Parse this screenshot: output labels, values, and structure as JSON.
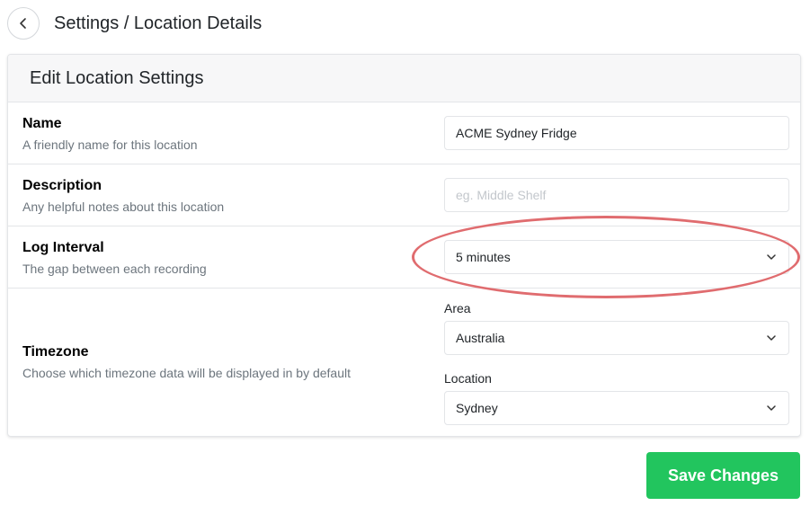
{
  "header": {
    "breadcrumb": "Settings / Location Details"
  },
  "card": {
    "title": "Edit Location Settings",
    "name": {
      "label": "Name",
      "help": "A friendly name for this location",
      "value": "ACME Sydney Fridge"
    },
    "description": {
      "label": "Description",
      "help": "Any helpful notes about this location",
      "placeholder": "eg. Middle Shelf"
    },
    "log_interval": {
      "label": "Log Interval",
      "help": "The gap between each recording",
      "value": "5 minutes"
    },
    "timezone": {
      "label": "Timezone",
      "help": "Choose which timezone data will be displayed in by default",
      "area_label": "Area",
      "area_value": "Australia",
      "location_label": "Location",
      "location_value": "Sydney"
    }
  },
  "save_button": {
    "label": "Save Changes"
  },
  "colors": {
    "save": "#22c55e",
    "highlight": "#e06c6f"
  }
}
